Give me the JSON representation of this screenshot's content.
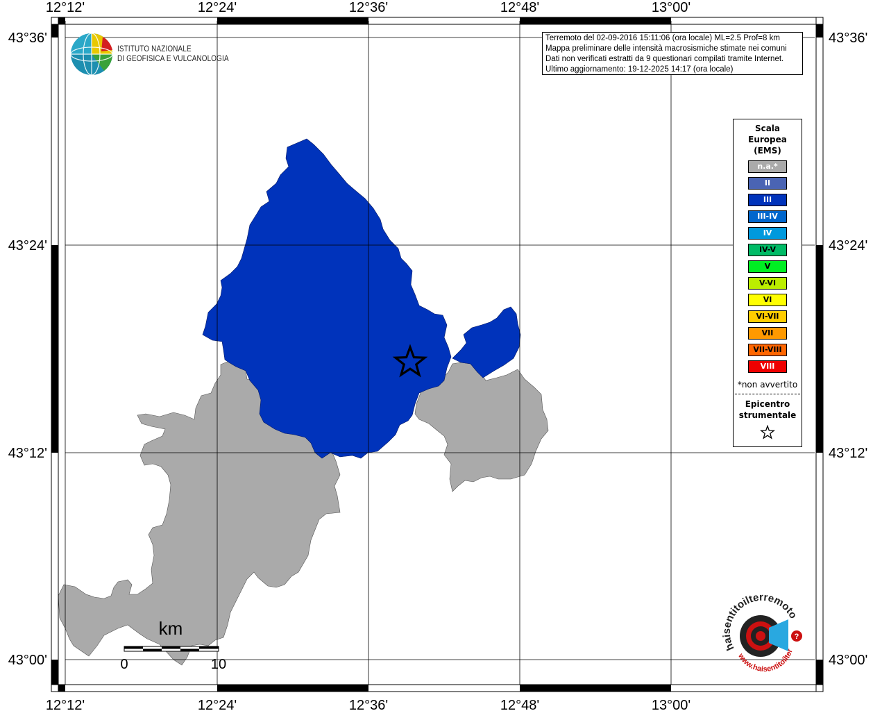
{
  "map": {
    "lon_labels": [
      "12°12'",
      "12°24'",
      "12°36'",
      "12°48'",
      "13°00'"
    ],
    "lat_labels": [
      "43°36'",
      "43°24'",
      "43°12'",
      "43°00'"
    ],
    "scale_bar": {
      "unit": "km",
      "start_label": "0",
      "end_label": "10"
    },
    "regions": [
      {
        "name": "III",
        "color": "#0033bb"
      },
      {
        "name": "n.a.*",
        "color": "#aaaaaa"
      }
    ],
    "epicenter_icon": "star-icon"
  },
  "info": {
    "line1": "Terremoto del 02-09-2016 15:11:06 (ora locale) ML=2.5 Prof=8 km",
    "line2": "Mappa preliminare delle intensità macrosismiche stimate nei comuni",
    "line3": "Dati non verificati estratti da 9 questionari compilati tramite Internet.",
    "line4": "Ultimo aggiornamento: 19-12-2025 14:17 (ora locale)"
  },
  "legend": {
    "title_line1": "Scala",
    "title_line2": "Europea",
    "title_line3": "(EMS)",
    "items": [
      {
        "label": "n.a.*",
        "color": "#aaaaaa",
        "text_color": "#ffffff"
      },
      {
        "label": "II",
        "color": "#4a64b4",
        "text_color": "#ffffff"
      },
      {
        "label": "III",
        "color": "#0033bb",
        "text_color": "#ffffff"
      },
      {
        "label": "III-IV",
        "color": "#0066cc",
        "text_color": "#ffffff"
      },
      {
        "label": "IV",
        "color": "#0099dd",
        "text_color": "#ffffff"
      },
      {
        "label": "IV-V",
        "color": "#00bb66",
        "text_color": "#000000"
      },
      {
        "label": "V",
        "color": "#00ee22",
        "text_color": "#000000"
      },
      {
        "label": "V-VI",
        "color": "#bbee00",
        "text_color": "#000000"
      },
      {
        "label": "VI",
        "color": "#ffff00",
        "text_color": "#000000"
      },
      {
        "label": "VI-VII",
        "color": "#ffcc00",
        "text_color": "#000000"
      },
      {
        "label": "VII",
        "color": "#ff9900",
        "text_color": "#000000"
      },
      {
        "label": "VII-VIII",
        "color": "#ff6600",
        "text_color": "#000000"
      },
      {
        "label": "VIII",
        "color": "#ee0000",
        "text_color": "#ffffff"
      }
    ],
    "note": "*non avvertito",
    "epicenter_line1": "Epicentro",
    "epicenter_line2": "strumentale"
  },
  "logos": {
    "ingv_line1": "ISTITUTO NAZIONALE",
    "ingv_line2": "DI GEOFISICA E VULCANOLOGIA",
    "hsit_text": "haisentitoilterremoto.it",
    "hsit_url": "www.haisentitoilterremoto.it"
  }
}
